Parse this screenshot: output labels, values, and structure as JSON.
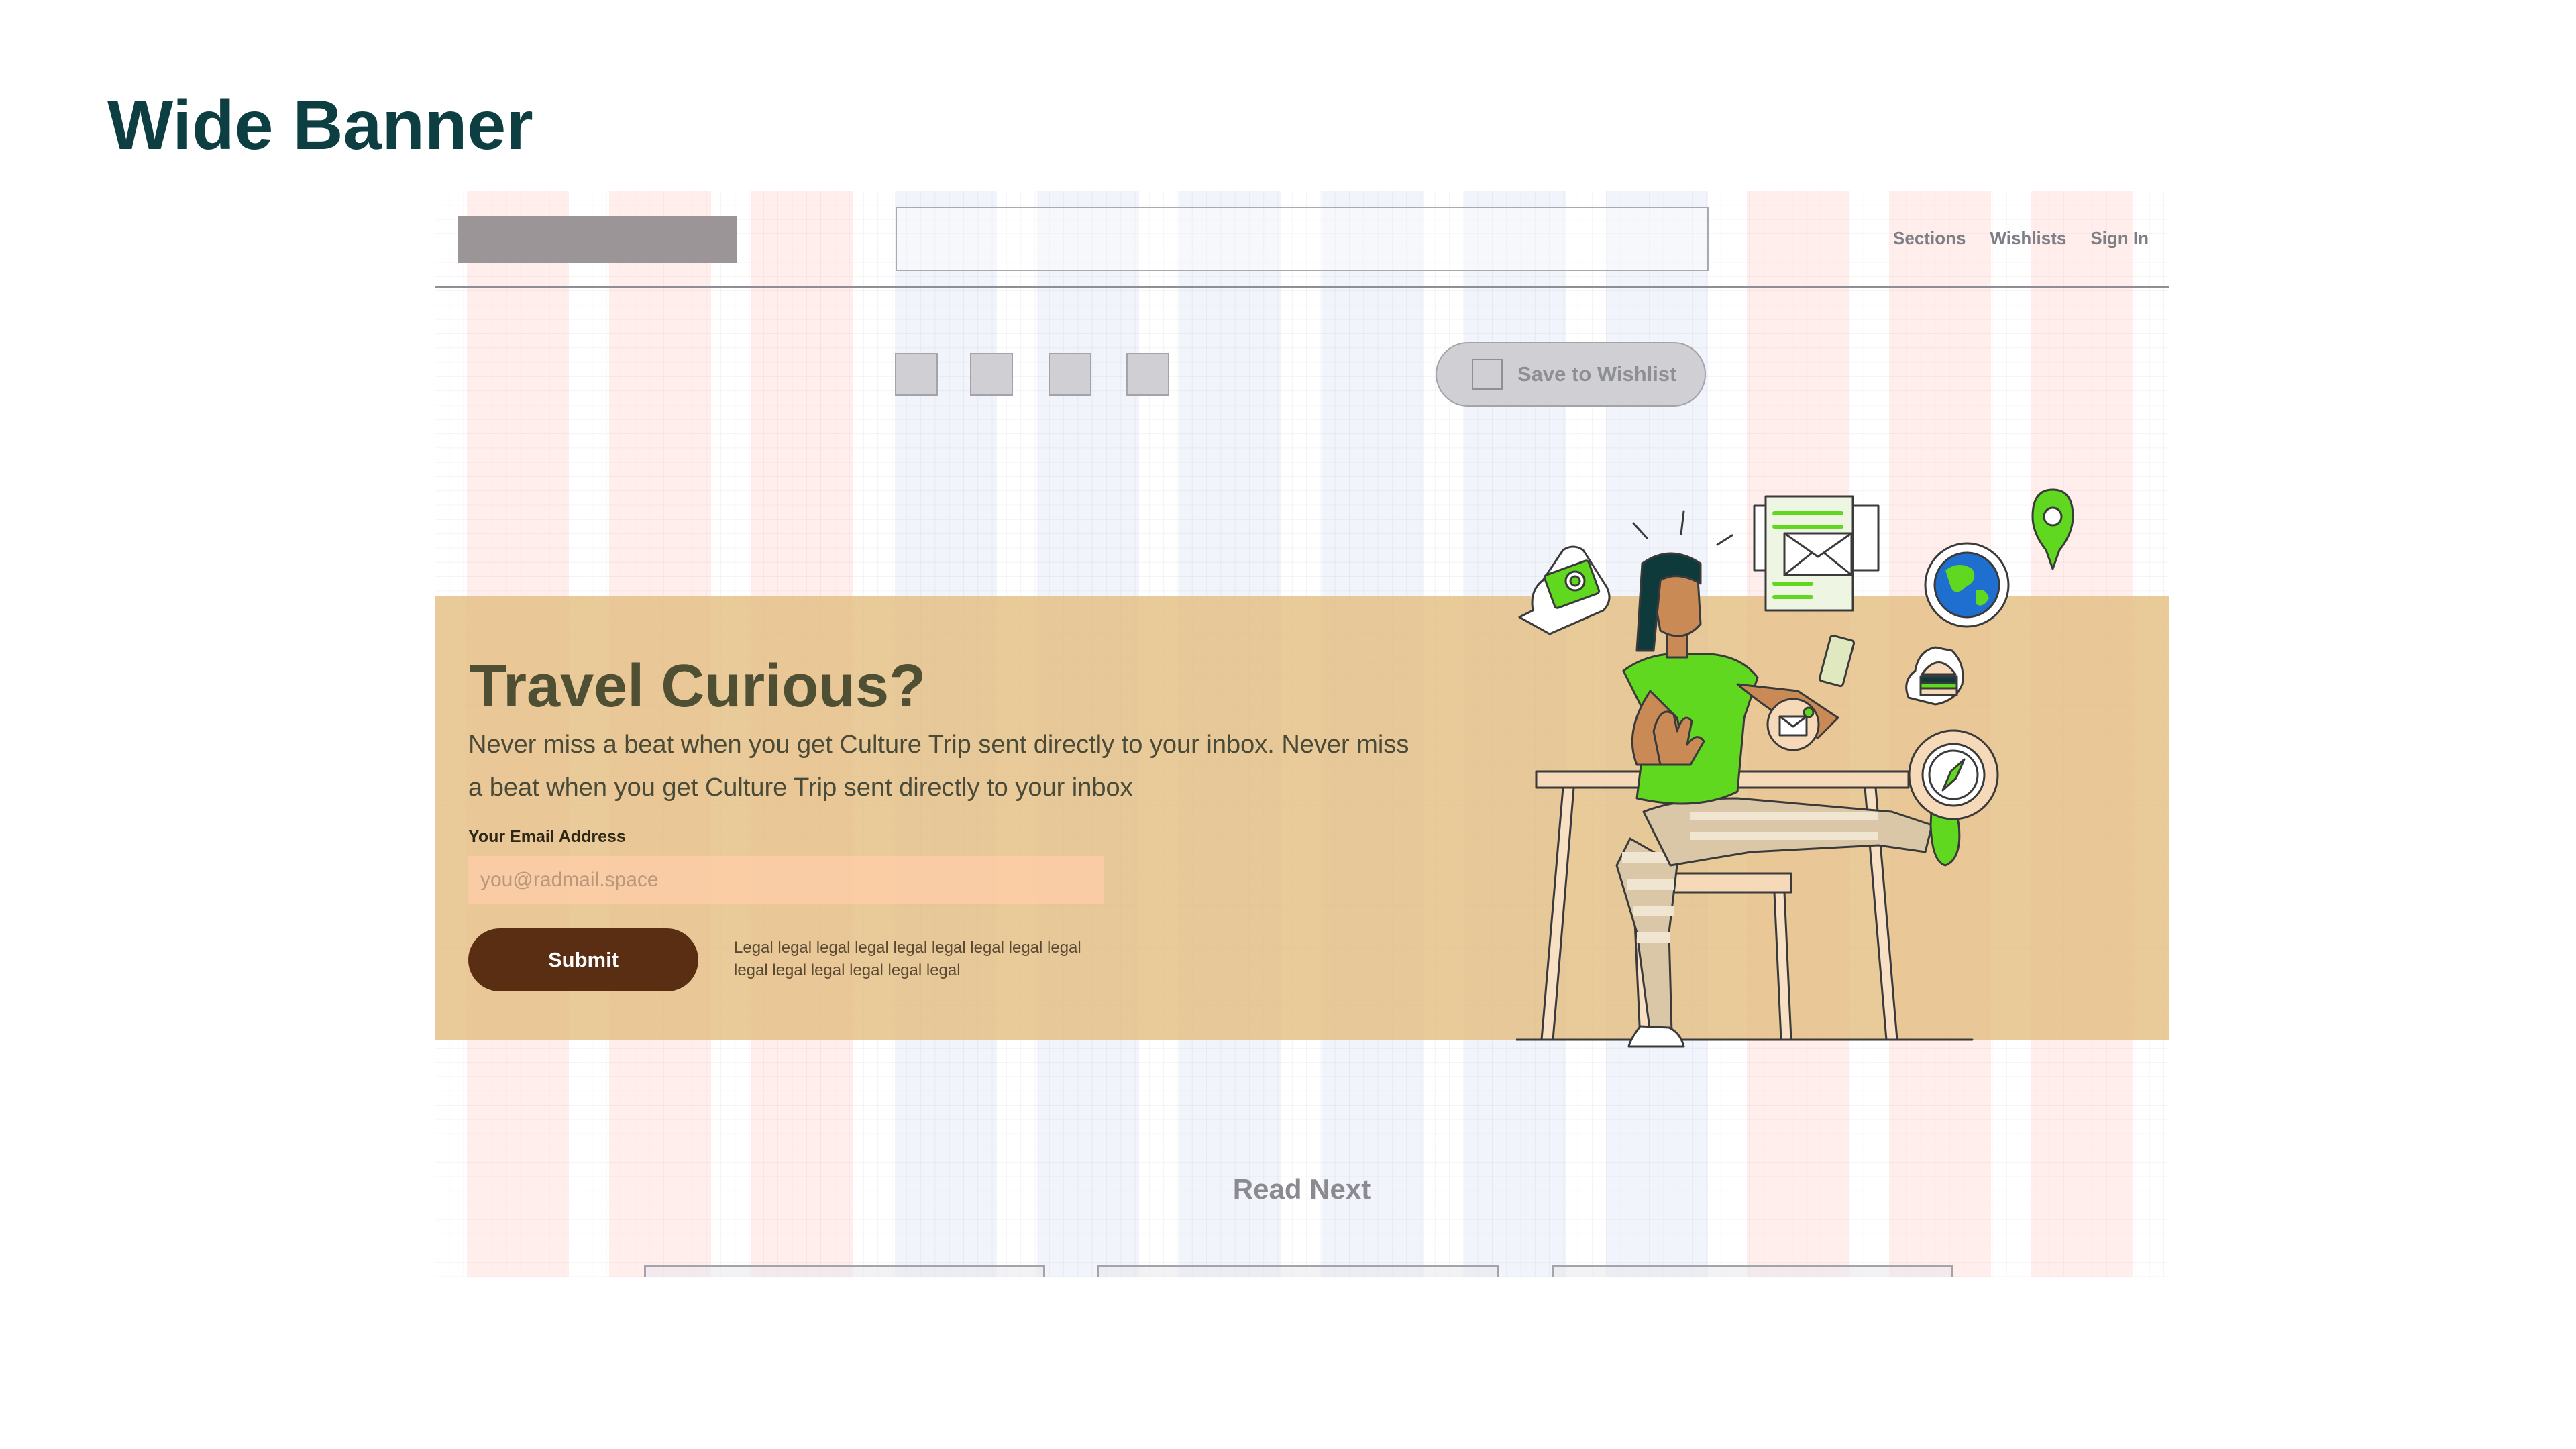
{
  "page": {
    "title": "Wide Banner"
  },
  "header": {
    "nav": [
      "Sections",
      "Wishlists",
      "Sign In"
    ]
  },
  "article_actions": {
    "wishlist_label": "Save to Wishlist"
  },
  "banner": {
    "heading": "Travel Curious?",
    "body": "Never miss a beat when you get Culture Trip sent directly to your inbox. Never miss a beat when you get Culture Trip sent directly to your inbox",
    "email_label": "Your Email Address",
    "email_placeholder": "you@radmail.space",
    "submit_label": "Submit",
    "legal": "Legal legal legal legal legal legal legal legal legal legal legal legal legal legal legal"
  },
  "read_next": {
    "heading": "Read Next"
  },
  "colors": {
    "title": "#0d3f42",
    "banner_bg": "#e4be82",
    "submit_bg": "#5a2e12",
    "illustration_green": "#5fd81f"
  }
}
